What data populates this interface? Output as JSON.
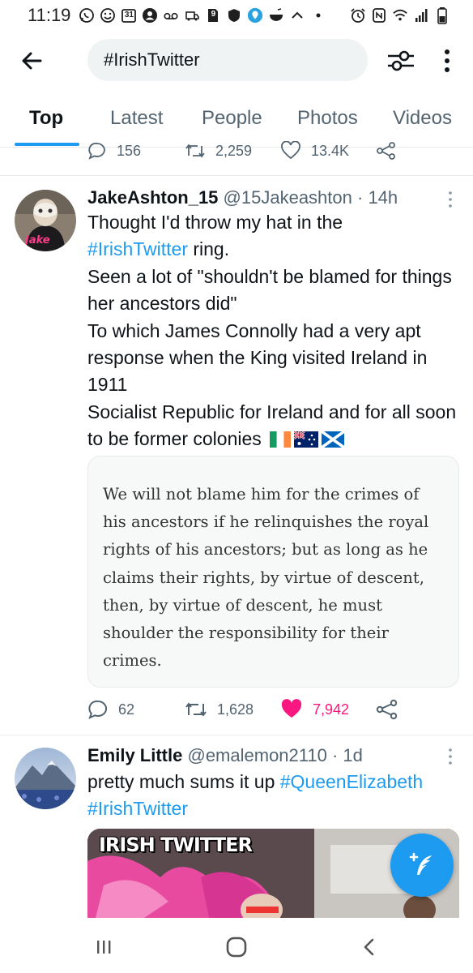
{
  "status_bar": {
    "time": "11:19",
    "calendar_day": "31",
    "sim_label": "9"
  },
  "search": {
    "query": "#IrishTwitter"
  },
  "tabs": [
    {
      "label": "Top",
      "active": true
    },
    {
      "label": "Latest",
      "active": false
    },
    {
      "label": "People",
      "active": false
    },
    {
      "label": "Photos",
      "active": false
    },
    {
      "label": "Videos",
      "active": false
    }
  ],
  "previous_tweet": {
    "replies": "156",
    "retweets": "2,259",
    "likes": "13.4K"
  },
  "tweets": [
    {
      "name": "JakeAshton_15",
      "handle": "@15Jakeashton",
      "time": "· 14h",
      "avatar_label": "Jake",
      "text_line_1": "Thought I'd throw my hat in the",
      "hashtag": "#IrishTwitter",
      "text_after_hashtag": " ring.",
      "text_rest": "Seen a lot of \"shouldn't be blamed for things her ancestors did\"\nTo which James Connolly had a very apt response when the King visited Ireland in 1911\nSocialist Republic for Ireland and for all soon to be former colonies",
      "quote": "We will not blame him for the crimes of his ancestors if he relinquishes the royal rights of his ancestors; but as long as he claims their rights, by virtue of descent, then, by virtue of descent, he must shoulder the responsibility for their crimes.",
      "replies": "62",
      "retweets": "1,628",
      "likes": "7,942",
      "liked": true,
      "like_color": "#f91880"
    },
    {
      "name": "Emily Little",
      "handle": "@emalemon2110",
      "time": "· 1d",
      "text_plain": "pretty much sums it up ",
      "hashtag_1": "#QueenElizabeth",
      "hashtag_2": "#IrishTwitter",
      "media_caption": "IRISH TWITTER"
    }
  ],
  "colors": {
    "accent": "#1d9bf0",
    "text": "#0f1419",
    "secondary_text": "#536471",
    "like": "#f91880"
  },
  "icons": {
    "back": "arrow-left-icon",
    "filter": "sliders-icon",
    "more": "more-vertical-icon",
    "compose": "feather-plus-icon",
    "nav_recents": "recents-icon",
    "nav_home": "home-icon",
    "nav_back": "back-chevron-icon"
  }
}
